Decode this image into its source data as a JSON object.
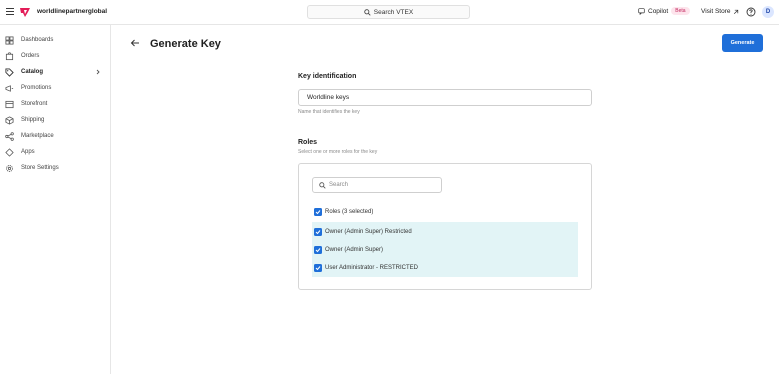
{
  "account": {
    "name": "worldlinepartnerglobal"
  },
  "topbar": {
    "search_label": "Search VTEX",
    "copilot_label": "Copilot",
    "copilot_badge": "Beta",
    "visit_store_label": "Visit Store",
    "avatar_initial": "D"
  },
  "sidebar": {
    "items": [
      {
        "label": "Dashboards",
        "icon": "dashboard-icon"
      },
      {
        "label": "Orders",
        "icon": "orders-icon"
      },
      {
        "label": "Catalog",
        "icon": "tag-icon",
        "active": true,
        "has_children": true
      },
      {
        "label": "Promotions",
        "icon": "megaphone-icon"
      },
      {
        "label": "Storefront",
        "icon": "storefront-icon"
      },
      {
        "label": "Shipping",
        "icon": "box-icon"
      },
      {
        "label": "Marketplace",
        "icon": "share-icon"
      },
      {
        "label": "Apps",
        "icon": "apps-icon"
      },
      {
        "label": "Store Settings",
        "icon": "gear-icon"
      }
    ]
  },
  "page": {
    "title": "Generate Key",
    "generate_button": "Generate"
  },
  "key_identification": {
    "title": "Key identification",
    "input_value": "Worldline keys",
    "help": "Name that identifies the key"
  },
  "roles": {
    "title": "Roles",
    "subtitle": "Select one or more roles for the key",
    "search_placeholder": "Search",
    "items": [
      {
        "label": "Roles (3 selected)",
        "checked": true,
        "highlighted": false
      },
      {
        "label": "Owner (Admin Super) Restricted",
        "checked": true,
        "highlighted": true
      },
      {
        "label": "Owner (Admin Super)",
        "checked": true,
        "highlighted": true
      },
      {
        "label": "User Administrator - RESTRICTED",
        "checked": true,
        "highlighted": true
      }
    ]
  },
  "colors": {
    "primary": "#1f6fd9",
    "selected_row": "#e2f4f6",
    "brand_logo": "#e31c58",
    "beta_badge": "#c2255c"
  }
}
